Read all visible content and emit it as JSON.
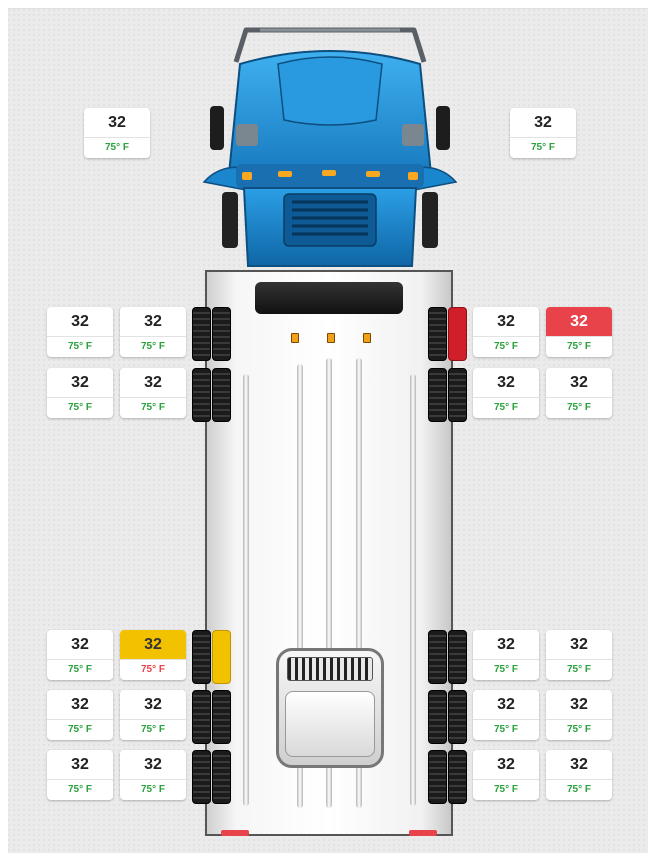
{
  "colors": {
    "ok_temp": "#2aa23d",
    "alert_red": "#e8434b",
    "alert_yellow": "#f2c200",
    "cab_blue": "#1c8fd6"
  },
  "steer": {
    "left": {
      "pressure": "32",
      "temp": "75° F",
      "status": "ok"
    },
    "right": {
      "pressure": "32",
      "temp": "75° F",
      "status": "ok"
    }
  },
  "axles": [
    {
      "left_outer": {
        "pressure": "32",
        "temp": "75° F",
        "status": "ok"
      },
      "left_inner": {
        "pressure": "32",
        "temp": "75° F",
        "status": "ok"
      },
      "right_inner": {
        "pressure": "32",
        "temp": "75° F",
        "status": "ok"
      },
      "right_outer": {
        "pressure": "32",
        "temp": "75° F",
        "status": "pressure-alert"
      }
    },
    {
      "left_outer": {
        "pressure": "32",
        "temp": "75° F",
        "status": "ok"
      },
      "left_inner": {
        "pressure": "32",
        "temp": "75° F",
        "status": "ok"
      },
      "right_inner": {
        "pressure": "32",
        "temp": "75° F",
        "status": "ok"
      },
      "right_outer": {
        "pressure": "32",
        "temp": "75° F",
        "status": "ok"
      }
    },
    {
      "left_outer": {
        "pressure": "32",
        "temp": "75° F",
        "status": "ok"
      },
      "left_inner": {
        "pressure": "32",
        "temp": "75° F",
        "status": "warning"
      },
      "right_inner": {
        "pressure": "32",
        "temp": "75° F",
        "status": "ok"
      },
      "right_outer": {
        "pressure": "32",
        "temp": "75° F",
        "status": "ok"
      }
    },
    {
      "left_outer": {
        "pressure": "32",
        "temp": "75° F",
        "status": "ok"
      },
      "left_inner": {
        "pressure": "32",
        "temp": "75° F",
        "status": "ok"
      },
      "right_inner": {
        "pressure": "32",
        "temp": "75° F",
        "status": "ok"
      },
      "right_outer": {
        "pressure": "32",
        "temp": "75° F",
        "status": "ok"
      }
    },
    {
      "left_outer": {
        "pressure": "32",
        "temp": "75° F",
        "status": "ok"
      },
      "left_inner": {
        "pressure": "32",
        "temp": "75° F",
        "status": "ok"
      },
      "right_inner": {
        "pressure": "32",
        "temp": "75° F",
        "status": "ok"
      },
      "right_outer": {
        "pressure": "32",
        "temp": "75° F",
        "status": "ok"
      }
    }
  ]
}
